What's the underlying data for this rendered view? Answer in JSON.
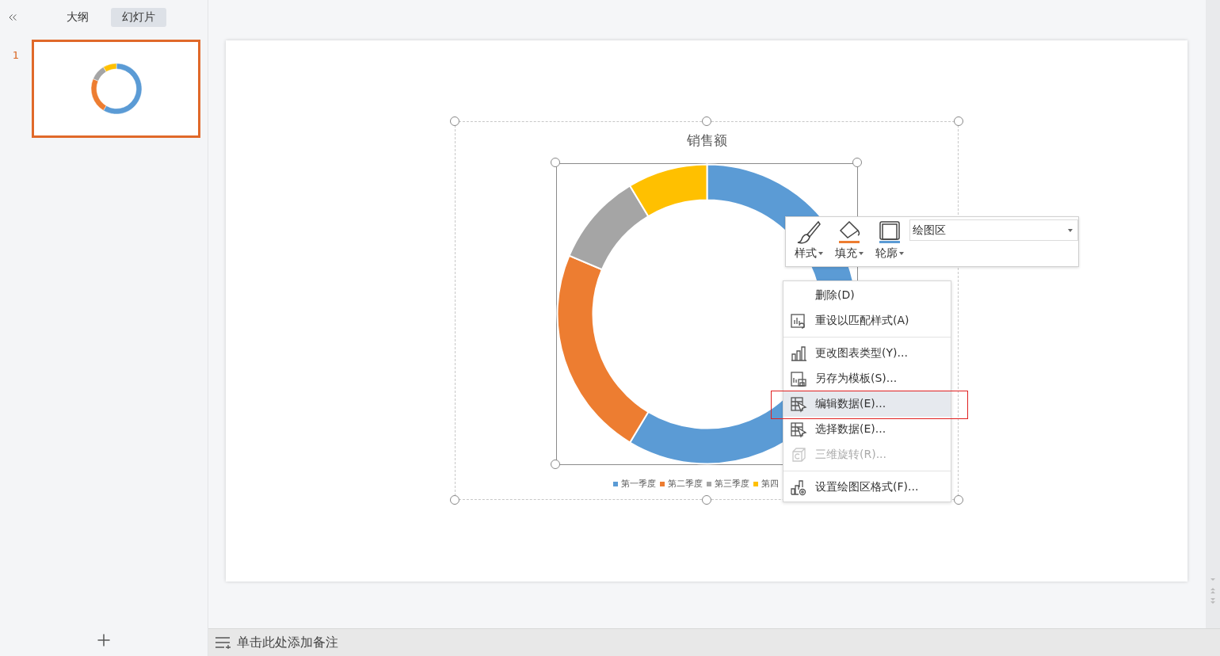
{
  "sidebar": {
    "tabs": [
      {
        "label": "大纲",
        "selected": false
      },
      {
        "label": "幻灯片",
        "selected": true
      }
    ],
    "slides": [
      {
        "number": "1",
        "selected": true
      }
    ]
  },
  "chart": {
    "title": "销售额",
    "legend": [
      {
        "label": "第一季度",
        "color": "#5b9bd5"
      },
      {
        "label": "第二季度",
        "color": "#ed7d31"
      },
      {
        "label": "第三季度",
        "color": "#a5a5a5"
      },
      {
        "label": "第四",
        "color": "#ffc000"
      }
    ]
  },
  "mini_toolbar": {
    "buttons": [
      {
        "label": "样式",
        "kind": "brush"
      },
      {
        "label": "填充",
        "kind": "fill"
      },
      {
        "label": "轮廓",
        "kind": "outline"
      }
    ],
    "element_select": {
      "value": "绘图区"
    }
  },
  "context_menu": {
    "groups": [
      [
        {
          "label": "删除(D)",
          "kind": "text",
          "disabled": false,
          "selected": false
        },
        {
          "label": "重设以匹配样式(A)",
          "kind": "reset",
          "disabled": false,
          "selected": false
        }
      ],
      [
        {
          "label": "更改图表类型(Y)...",
          "kind": "charttype",
          "disabled": false,
          "selected": false
        },
        {
          "label": "另存为模板(S)...",
          "kind": "template",
          "disabled": false,
          "selected": false
        },
        {
          "label": "编辑数据(E)...",
          "kind": "editdata",
          "disabled": false,
          "selected": true
        },
        {
          "label": "选择数据(E)...",
          "kind": "selectdata",
          "disabled": false,
          "selected": false
        },
        {
          "label": "三维旋转(R)...",
          "kind": "rotate",
          "disabled": true,
          "selected": false
        }
      ],
      [
        {
          "label": "设置绘图区格式(F)...",
          "kind": "format",
          "disabled": false,
          "selected": false
        }
      ]
    ]
  },
  "notes": {
    "placeholder": "单击此处添加备注"
  }
}
